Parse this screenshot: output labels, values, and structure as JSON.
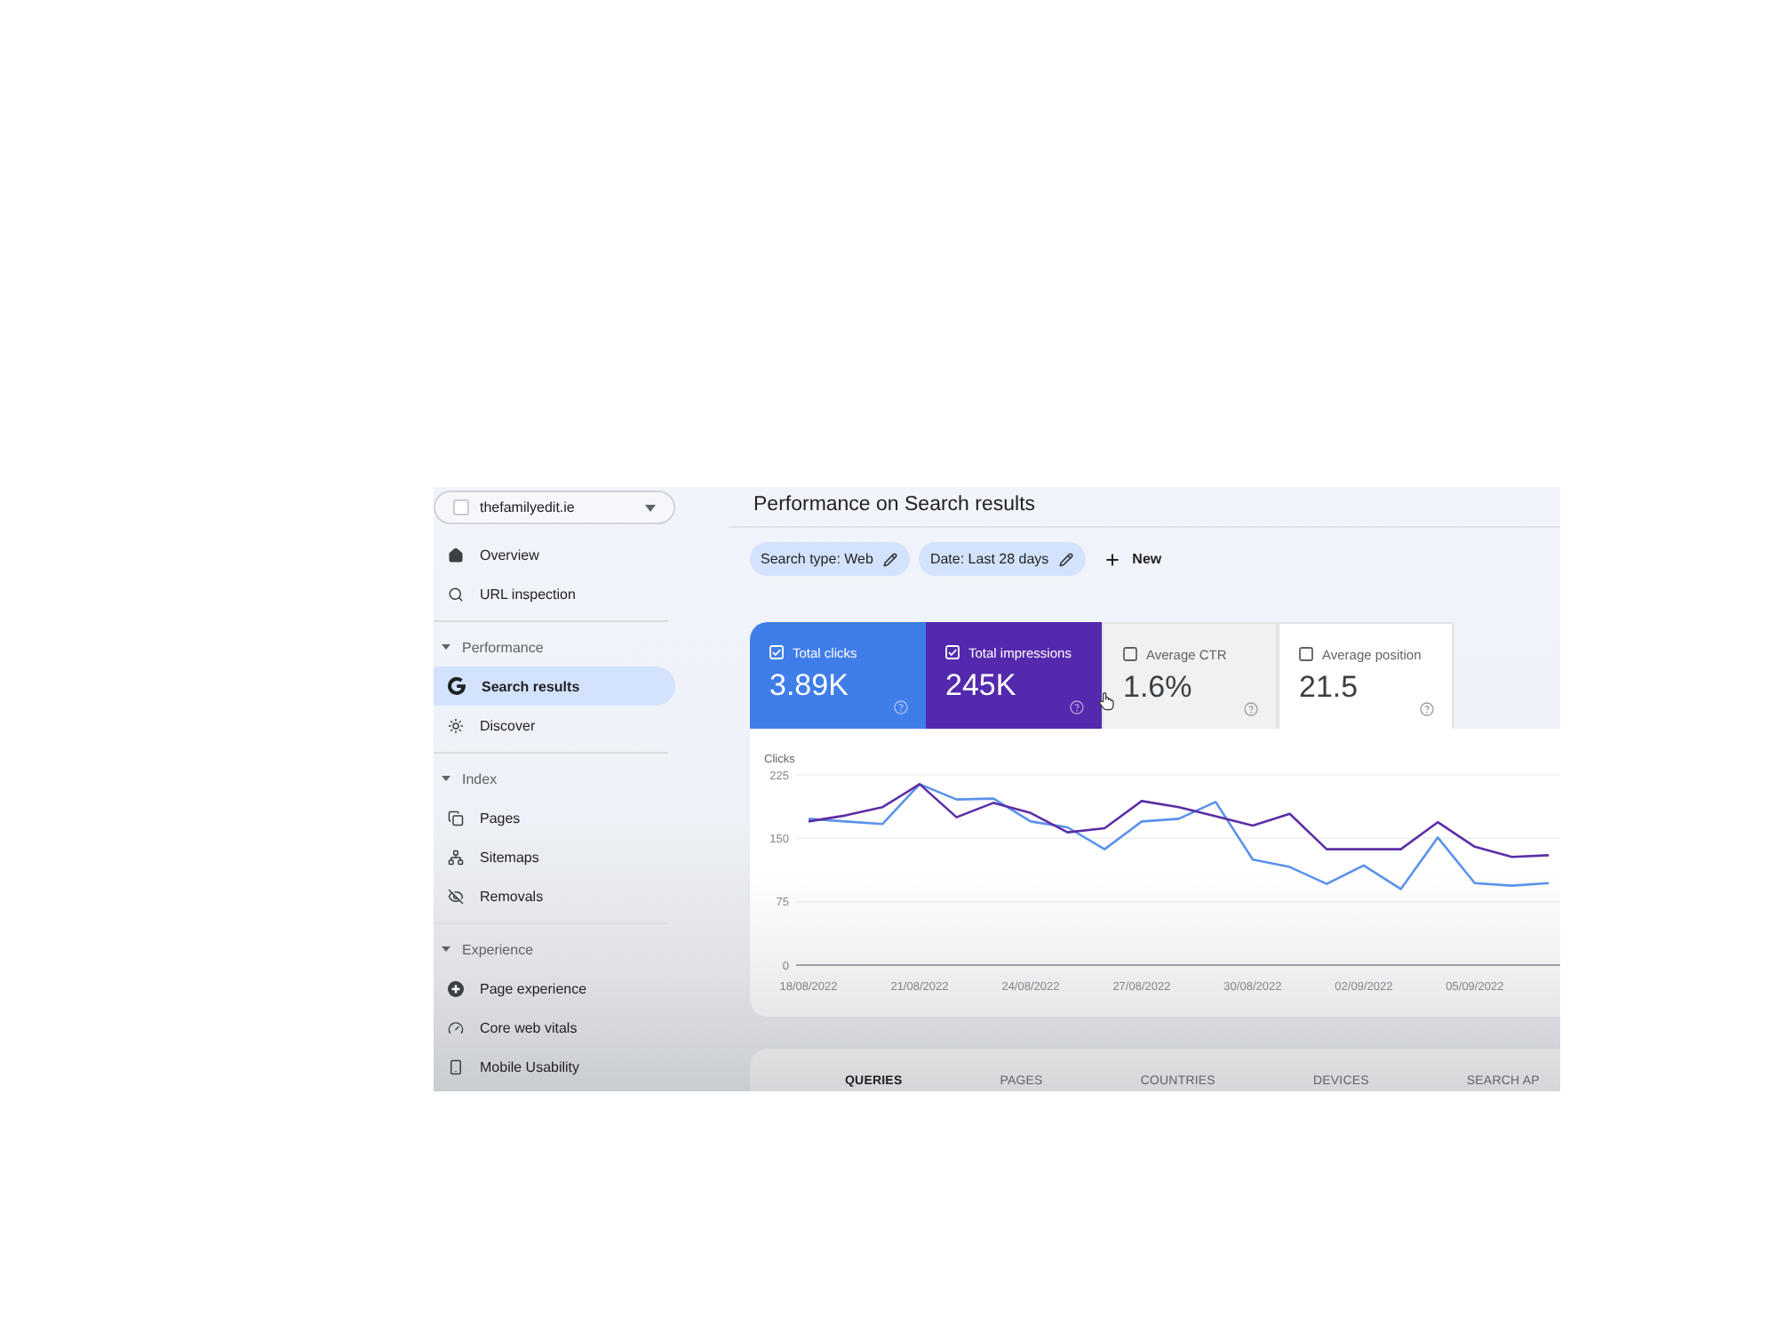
{
  "property_selector": {
    "label": "thefamilyedit.ie"
  },
  "sidebar": {
    "items": [
      {
        "label": "Overview",
        "selected": false
      },
      {
        "label": "URL inspection",
        "selected": false
      }
    ],
    "sections": [
      {
        "title": "Performance",
        "expanded": true,
        "children": [
          {
            "label": "Search results",
            "selected": true
          },
          {
            "label": "Discover",
            "selected": false
          }
        ]
      },
      {
        "title": "Index",
        "expanded": true,
        "children": [
          {
            "label": "Pages",
            "selected": false
          },
          {
            "label": "Sitemaps",
            "selected": false
          },
          {
            "label": "Removals",
            "selected": false
          }
        ]
      },
      {
        "title": "Experience",
        "expanded": true,
        "children": [
          {
            "label": "Page experience",
            "selected": false
          },
          {
            "label": "Core web vitals",
            "selected": false
          },
          {
            "label": "Mobile Usability",
            "selected": false
          }
        ]
      }
    ]
  },
  "page": {
    "title": "Performance on Search results"
  },
  "filters": [
    {
      "label": "Search type: Web"
    },
    {
      "label": "Date: Last 28 days"
    }
  ],
  "new_button": {
    "label": "New"
  },
  "metrics": [
    {
      "label": "Total clicks",
      "value": "3.89K",
      "checked": true,
      "hovered": false,
      "color": "#3f7de8"
    },
    {
      "label": "Total impressions",
      "value": "245K",
      "checked": true,
      "hovered": false,
      "color": "#5429ad"
    },
    {
      "label": "Average CTR",
      "value": "1.6%",
      "checked": false,
      "hovered": true
    },
    {
      "label": "Average position",
      "value": "21.5",
      "checked": false,
      "hovered": false
    }
  ],
  "chart": {
    "chart_data": {
      "type": "line",
      "ylabel": "Clicks",
      "categories": [
        "18/08/2022",
        null,
        null,
        "21/08/2022",
        null,
        null,
        "24/08/2022",
        null,
        null,
        "27/08/2022",
        null,
        null,
        "30/08/2022",
        null,
        null,
        "02/09/2022",
        null,
        null,
        "05/09/2022",
        null,
        null
      ],
      "ylim": [
        0,
        225
      ],
      "yticks": [
        0,
        75,
        150,
        225
      ],
      "series": [
        {
          "color": "#5b92ea",
          "values": [
            173,
            170,
            167,
            214,
            196,
            197,
            170,
            163,
            137,
            170,
            173,
            193,
            125,
            116,
            96,
            118,
            90,
            151,
            97,
            94,
            97
          ]
        },
        {
          "color": "#5b2ea6",
          "values": [
            170,
            177,
            187,
            214,
            175,
            192,
            180,
            157,
            162,
            194,
            187,
            176,
            165,
            179,
            137,
            137,
            137,
            169,
            140,
            128,
            130
          ]
        }
      ]
    }
  },
  "tabs": [
    {
      "label": "QUERIES",
      "selected": true
    },
    {
      "label": "PAGES",
      "selected": false
    },
    {
      "label": "COUNTRIES",
      "selected": false
    },
    {
      "label": "DEVICES",
      "selected": false
    },
    {
      "label": "SEARCH AP",
      "selected": false
    }
  ]
}
